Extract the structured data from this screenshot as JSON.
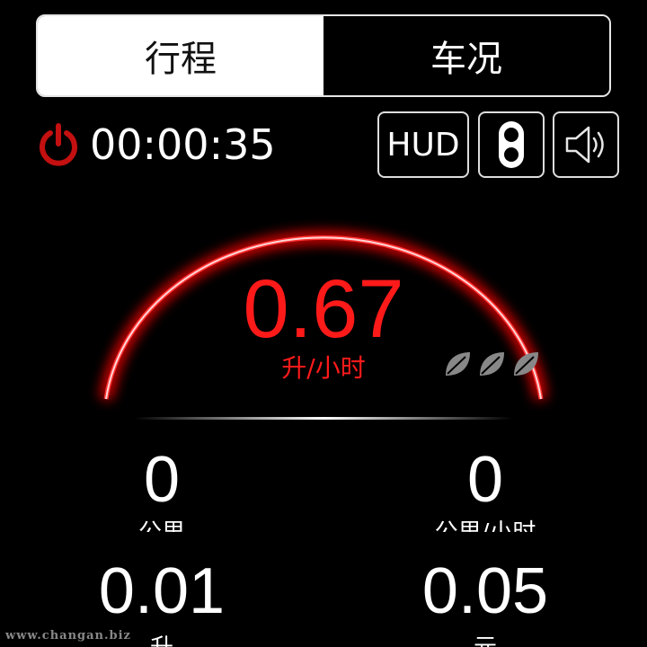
{
  "tabs": [
    {
      "label": "行程",
      "active": true
    },
    {
      "label": "车况",
      "active": false
    }
  ],
  "trip": {
    "elapsed_time": "00:00:35",
    "power_icon": "power-icon",
    "accent_color": "#cc1111"
  },
  "controls": {
    "hud_label": "HUD",
    "toggle_icon": "toggle-icon",
    "sound_icon": "speaker-icon"
  },
  "gauge": {
    "fuel_value": "0.67",
    "fuel_unit": "升/小时",
    "eco_leaves": 3,
    "color": "#ff1a1a"
  },
  "stats": [
    {
      "value": "0",
      "label": "公里"
    },
    {
      "value": "0",
      "label": "公里/小时"
    },
    {
      "value": "0.01",
      "label": "升"
    },
    {
      "value": "0.05",
      "label": "元"
    }
  ],
  "watermark": "www.changan.biz"
}
